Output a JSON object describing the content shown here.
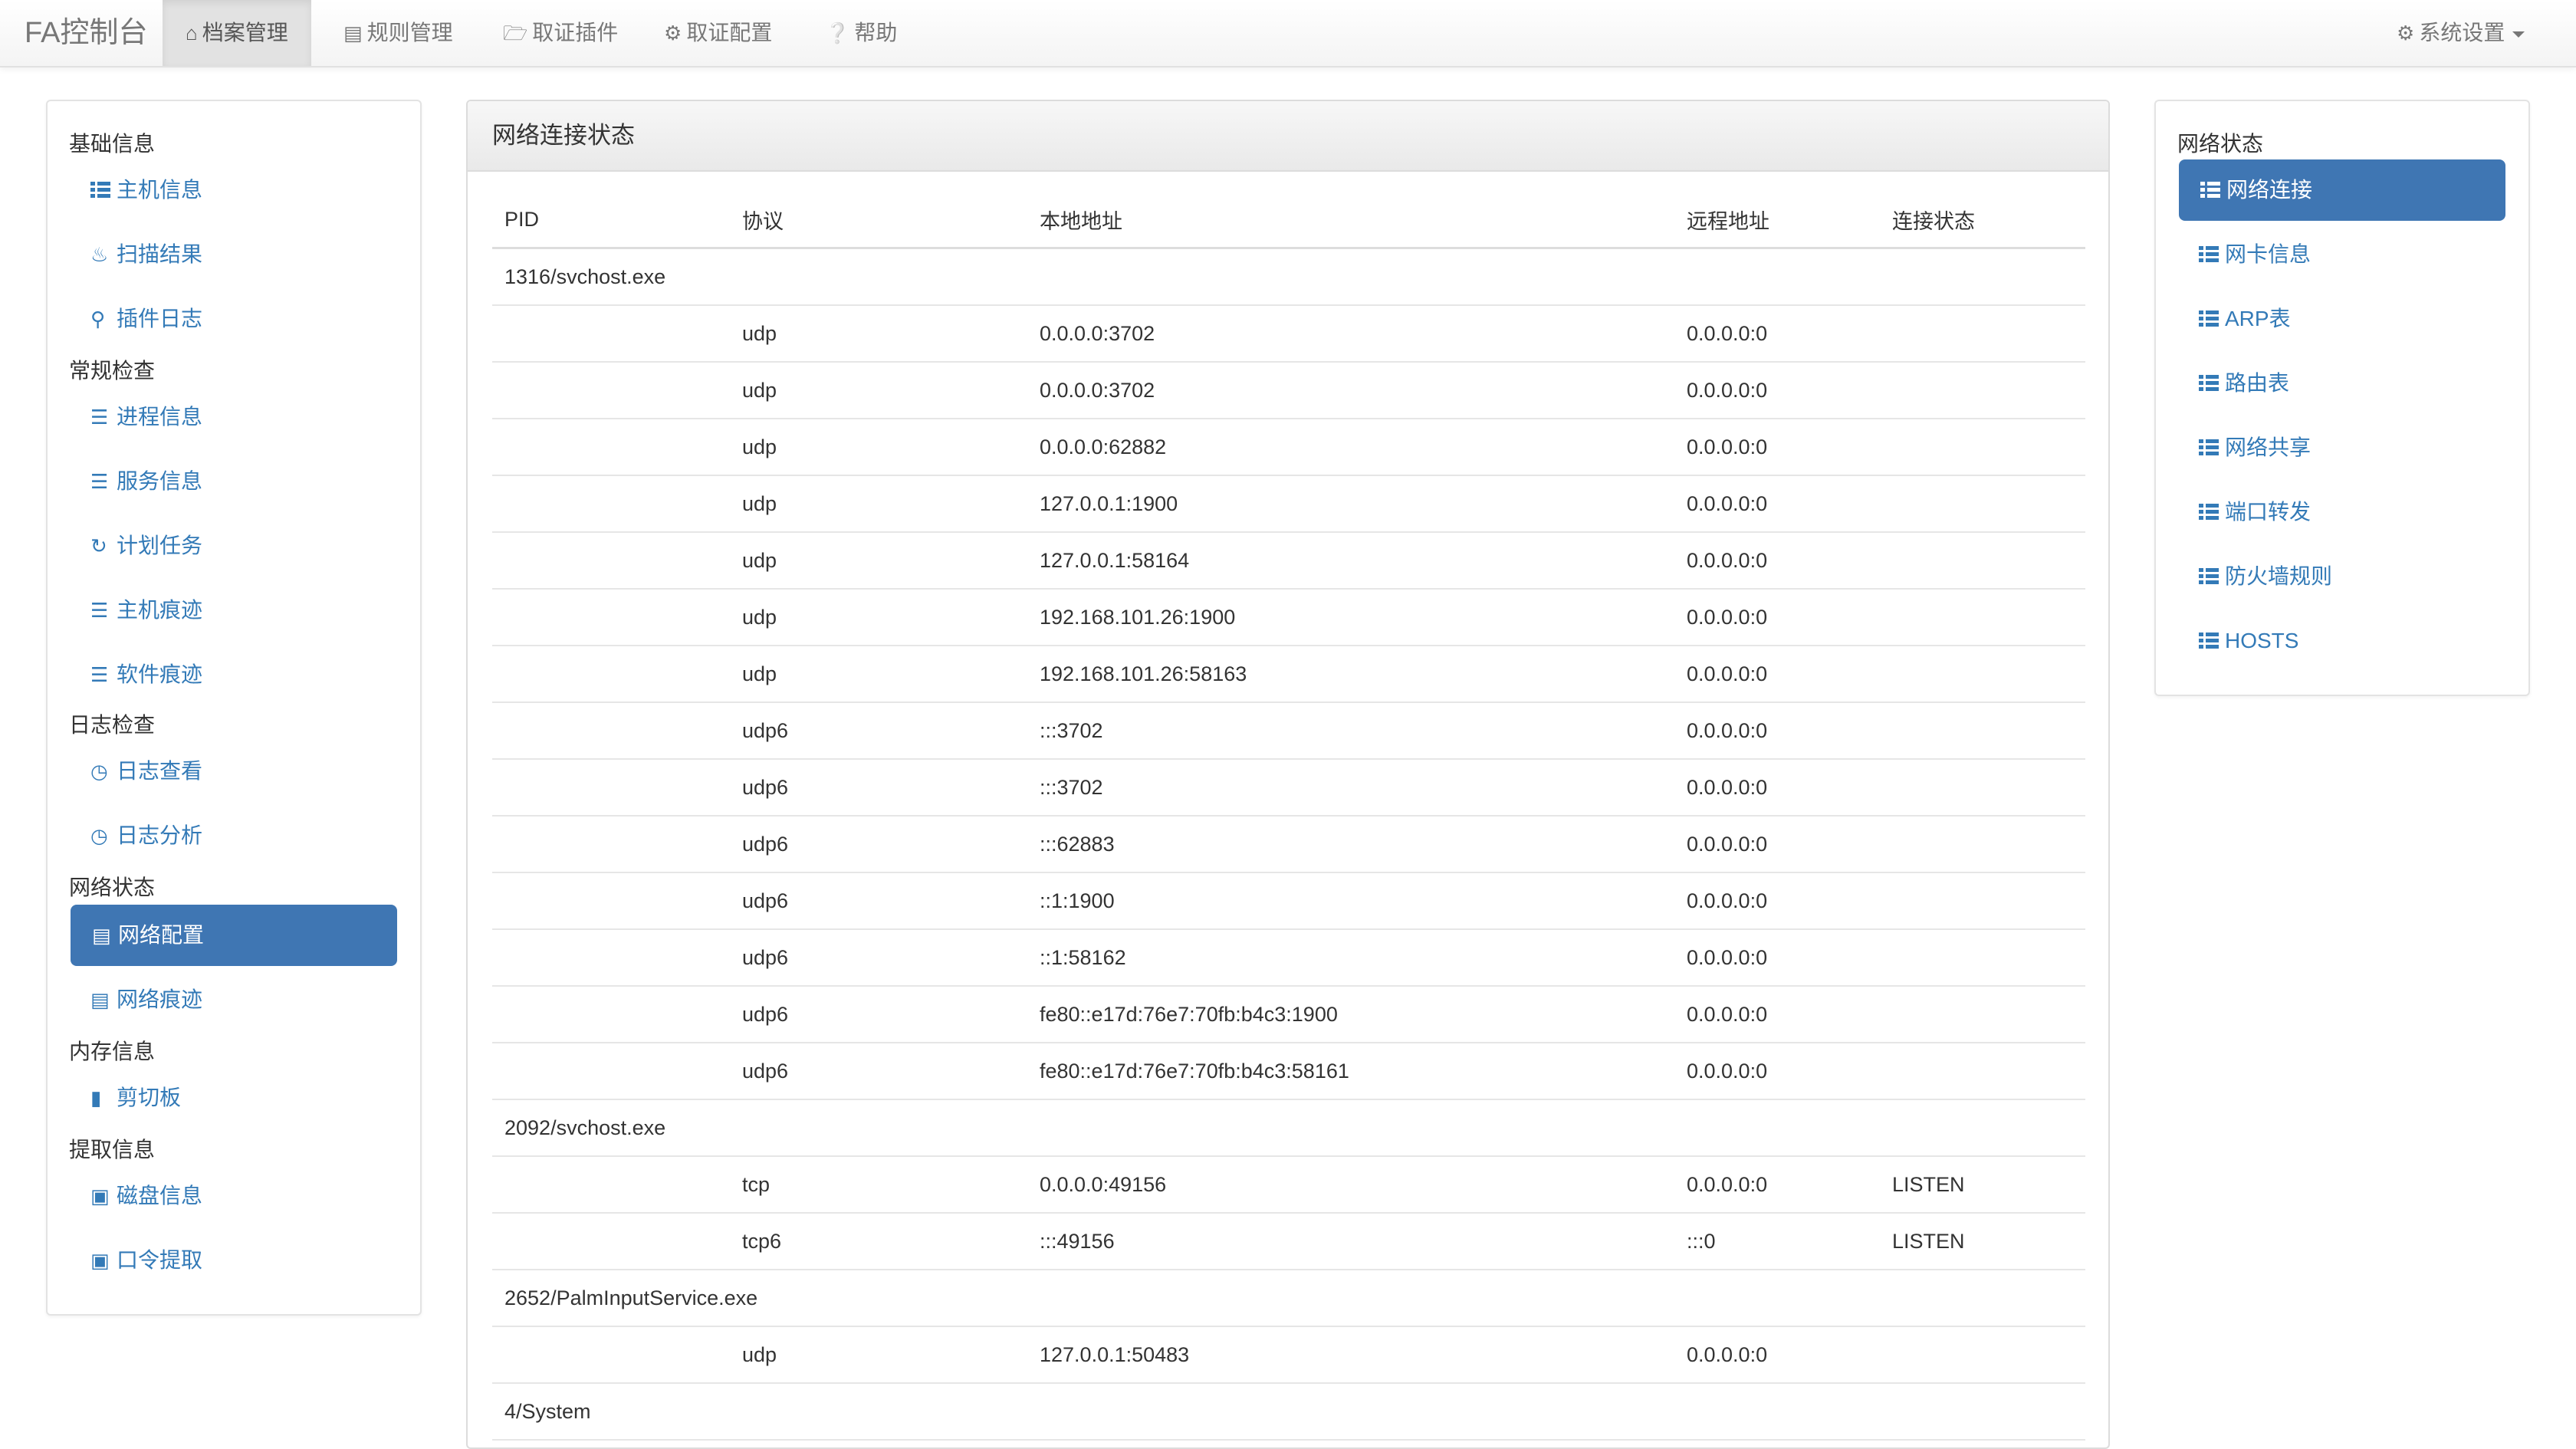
{
  "navbar": {
    "brand": "FA控制台",
    "items": [
      {
        "label": "档案管理",
        "icon": "home-icon",
        "active": true
      },
      {
        "label": "规则管理",
        "icon": "list-alt-icon"
      },
      {
        "label": "取证插件",
        "icon": "folder-open-icon"
      },
      {
        "label": "取证配置",
        "icon": "cog-icon"
      },
      {
        "label": "帮助",
        "icon": "question-circle-icon"
      }
    ],
    "settings": "系统设置"
  },
  "left_sidebar": {
    "sections": [
      {
        "title": "基础信息",
        "items": [
          "主机信息",
          "扫描结果",
          "插件日志"
        ]
      },
      {
        "title": "常规检查",
        "items": [
          "进程信息",
          "服务信息",
          "计划任务",
          "主机痕迹",
          "软件痕迹"
        ]
      },
      {
        "title": "日志检查",
        "items": [
          "日志查看",
          "日志分析"
        ]
      },
      {
        "title": "网络状态",
        "items": [
          "网络配置",
          "网络痕迹"
        ]
      },
      {
        "title": "内存信息",
        "items": [
          "剪切板"
        ]
      },
      {
        "title": "提取信息",
        "items": [
          "磁盘信息",
          "口令提取"
        ]
      }
    ],
    "active_item": "网络配置"
  },
  "right_sidebar": {
    "title": "网络状态",
    "items": [
      "网络连接",
      "网卡信息",
      "ARP表",
      "路由表",
      "网络共享",
      "端口转发",
      "防火墙规则",
      "HOSTS"
    ],
    "active_item": "网络连接"
  },
  "main": {
    "title": "网络连接状态",
    "columns": [
      "PID",
      "协议",
      "本地地址",
      "远程地址",
      "连接状态"
    ],
    "rows": [
      {
        "group": "1316/svchost.exe"
      },
      {
        "proto": "udp",
        "local": "0.0.0.0:3702",
        "remote": "0.0.0.0:0",
        "state": ""
      },
      {
        "proto": "udp",
        "local": "0.0.0.0:3702",
        "remote": "0.0.0.0:0",
        "state": ""
      },
      {
        "proto": "udp",
        "local": "0.0.0.0:62882",
        "remote": "0.0.0.0:0",
        "state": ""
      },
      {
        "proto": "udp",
        "local": "127.0.0.1:1900",
        "remote": "0.0.0.0:0",
        "state": ""
      },
      {
        "proto": "udp",
        "local": "127.0.0.1:58164",
        "remote": "0.0.0.0:0",
        "state": ""
      },
      {
        "proto": "udp",
        "local": "192.168.101.26:1900",
        "remote": "0.0.0.0:0",
        "state": ""
      },
      {
        "proto": "udp",
        "local": "192.168.101.26:58163",
        "remote": "0.0.0.0:0",
        "state": ""
      },
      {
        "proto": "udp6",
        "local": ":::3702",
        "remote": "0.0.0.0:0",
        "state": ""
      },
      {
        "proto": "udp6",
        "local": ":::3702",
        "remote": "0.0.0.0:0",
        "state": ""
      },
      {
        "proto": "udp6",
        "local": ":::62883",
        "remote": "0.0.0.0:0",
        "state": ""
      },
      {
        "proto": "udp6",
        "local": "::1:1900",
        "remote": "0.0.0.0:0",
        "state": ""
      },
      {
        "proto": "udp6",
        "local": "::1:58162",
        "remote": "0.0.0.0:0",
        "state": ""
      },
      {
        "proto": "udp6",
        "local": "fe80::e17d:76e7:70fb:b4c3:1900",
        "remote": "0.0.0.0:0",
        "state": ""
      },
      {
        "proto": "udp6",
        "local": "fe80::e17d:76e7:70fb:b4c3:58161",
        "remote": "0.0.0.0:0",
        "state": ""
      },
      {
        "group": "2092/svchost.exe"
      },
      {
        "proto": "tcp",
        "local": "0.0.0.0:49156",
        "remote": "0.0.0.0:0",
        "state": "LISTEN"
      },
      {
        "proto": "tcp6",
        "local": ":::49156",
        "remote": ":::0",
        "state": "LISTEN"
      },
      {
        "group": "2652/PalmInputService.exe"
      },
      {
        "proto": "udp",
        "local": "127.0.0.1:50483",
        "remote": "0.0.0.0:0",
        "state": ""
      },
      {
        "group": "4/System"
      }
    ]
  },
  "colors": {
    "link": "#337ab7",
    "active_bg": "#3f76b3",
    "text": "#333333"
  }
}
